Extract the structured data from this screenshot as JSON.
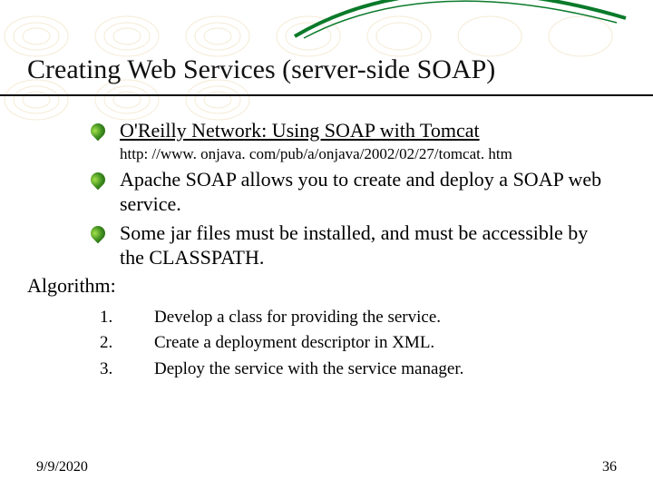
{
  "title": "Creating Web Services (server-side SOAP)",
  "bullets": [
    {
      "text": "O'Reilly Network: Using SOAP with Tomcat",
      "is_link": true,
      "sub": "http: //www. onjava. com/pub/a/onjava/2002/02/27/tomcat. htm"
    },
    {
      "text": "Apache SOAP allows you to create and deploy a SOAP web service."
    },
    {
      "text": "Some jar files must be installed, and must be accessible by the CLASSPATH."
    }
  ],
  "algorithm_label": "Algorithm:",
  "steps": [
    {
      "n": "1.",
      "text": "Develop a class for providing the service."
    },
    {
      "n": "2.",
      "text": "Create a deployment descriptor in XML."
    },
    {
      "n": "3.",
      "text": "Deploy the service with the service manager."
    }
  ],
  "footer": {
    "date": "9/9/2020",
    "page": "36"
  }
}
